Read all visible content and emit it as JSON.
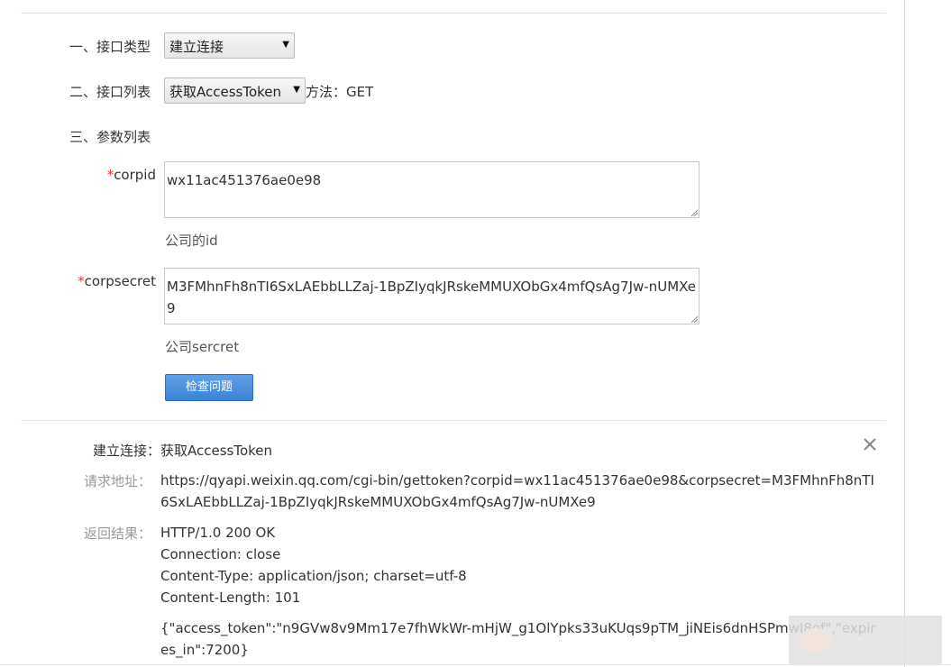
{
  "steps": {
    "type_label": "一、接口类型",
    "list_label": "二、接口列表",
    "params_label": "三、参数列表"
  },
  "interface_type": {
    "selected": "建立连接"
  },
  "interface_list": {
    "selected": "获取AccessToken"
  },
  "method_text": "方法：GET",
  "params": [
    {
      "required_mark": "*",
      "name": "corpid",
      "value": "wx11ac451376ae0e98",
      "hint": "公司的id"
    },
    {
      "required_mark": "*",
      "name": "corpsecret",
      "value": "M3FMhnFh8nTI6SxLAEbbLLZaj-1BpZIyqkJRskeMMUXObGx4mfQsAg7Jw-nUMXe9",
      "hint": "公司sercret"
    }
  ],
  "check_button_label": "检查问题",
  "result": {
    "title": "建立连接：获取AccessToken",
    "url_label": "请求地址：",
    "url": "https://qyapi.weixin.qq.com/cgi-bin/gettoken?corpid=wx11ac451376ae0e98&corpsecret=M3FMhnFh8nTI6SxLAEbbLLZaj-1BpZIyqkJRskeMMUXObGx4mfQsAg7Jw-nUMXe9",
    "response_label": "返回结果：",
    "headers": [
      "HTTP/1.0 200 OK",
      "Connection: close",
      "Content-Type: application/json; charset=utf-8",
      "Content-Length: 101"
    ],
    "body": "{\"access_token\":\"n9GVw8v9Mm17e7fhWkWr-mHjW_g1OlYpks33uKUqs9pTM_jiNEis6dnHSPmwI8of\",\"expires_in\":7200}"
  },
  "icons": {
    "close": "close-icon",
    "caret": "caret-down-icon",
    "grip": "resize-grip-icon"
  }
}
